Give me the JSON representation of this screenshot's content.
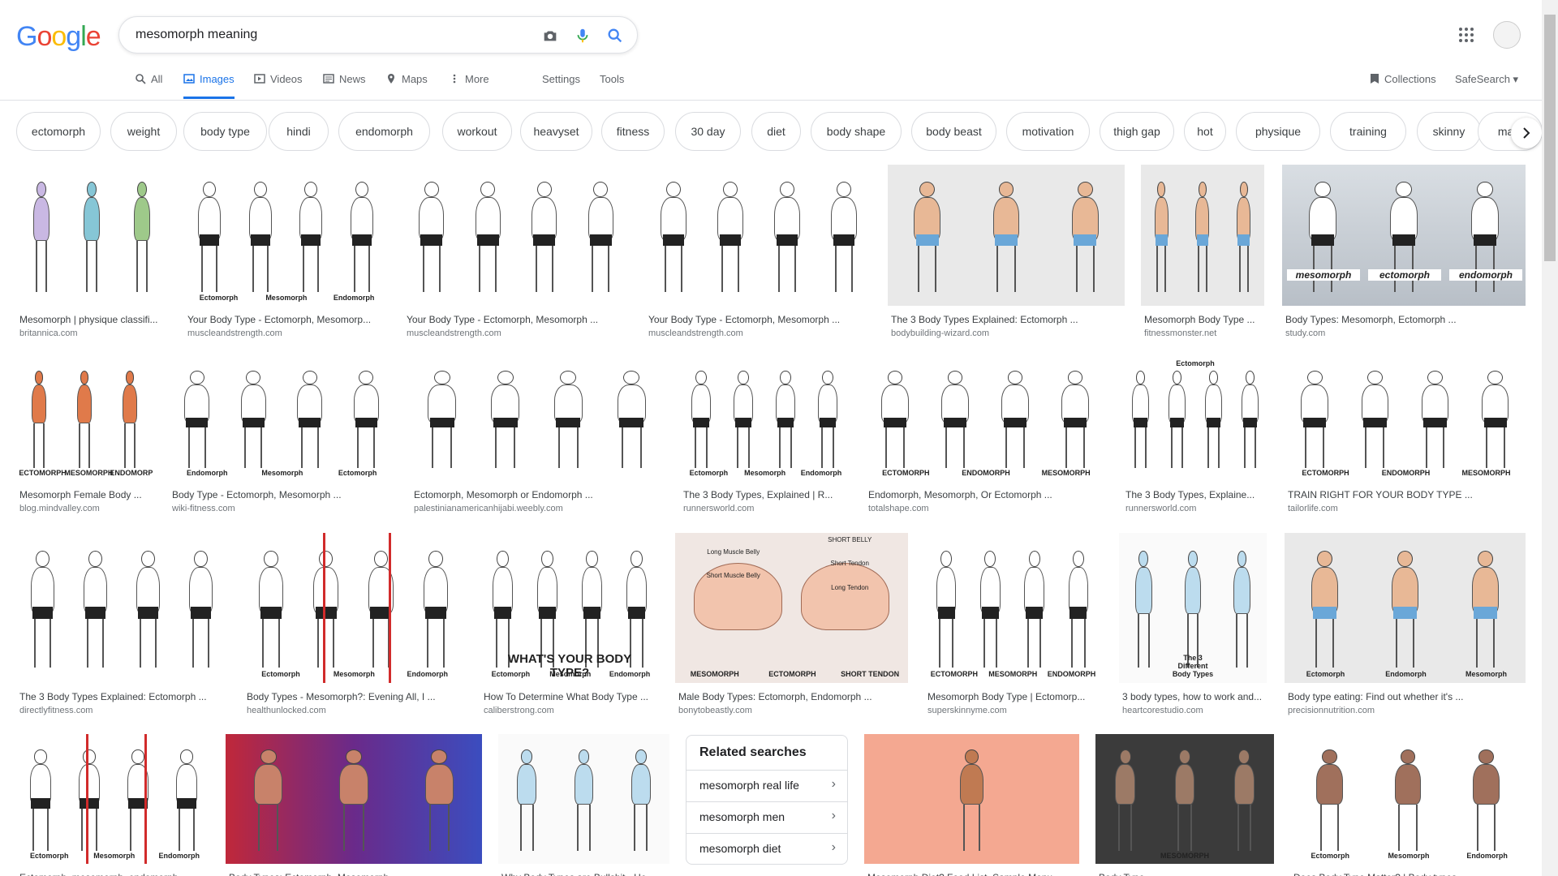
{
  "logo": {
    "letters": [
      "G",
      "o",
      "o",
      "g",
      "l",
      "e"
    ],
    "colors": [
      "#4285F4",
      "#EA4335",
      "#FBBC05",
      "#4285F4",
      "#34A853",
      "#EA4335"
    ]
  },
  "search": {
    "query": "mesomorph meaning"
  },
  "tabs": [
    {
      "label": "All",
      "icon": "search-icon"
    },
    {
      "label": "Images",
      "icon": "image-icon",
      "active": true
    },
    {
      "label": "Videos",
      "icon": "video-icon"
    },
    {
      "label": "News",
      "icon": "news-icon"
    },
    {
      "label": "Maps",
      "icon": "map-icon"
    },
    {
      "label": "More",
      "icon": "more-vert-icon"
    },
    {
      "label": "Settings"
    },
    {
      "label": "Tools"
    }
  ],
  "right_tools": {
    "collections": "Collections",
    "safesearch": "SafeSearch"
  },
  "chips": [
    "ectomorph",
    "weight",
    "body type",
    "hindi",
    "endomorph",
    "workout",
    "heavyset",
    "fitness",
    "30 day",
    "diet",
    "body shape",
    "body beast",
    "motivation",
    "thigh gap",
    "hot",
    "physique",
    "training",
    "skinny",
    "male"
  ],
  "results": [
    {
      "title": "Mesomorph | physique classifi...",
      "source": "britannica.com",
      "theme": "color",
      "labels": []
    },
    {
      "title": "Your Body Type - Ectomorph, Mesomorp...",
      "source": "muscleandstrength.com",
      "theme": "line",
      "labels": [
        "Ectomorph",
        "Mesomorph",
        "Endomorph"
      ]
    },
    {
      "title": "Your Body Type - Ectomorph, Mesomorph ...",
      "source": "muscleandstrength.com",
      "theme": "line",
      "labels": []
    },
    {
      "title": "Your Body Type - Ectomorph, Mesomorph ...",
      "source": "muscleandstrength.com",
      "theme": "line",
      "labels": []
    },
    {
      "title": "The 3 Body Types Explained: Ectomorph ...",
      "source": "bodybuilding-wizard.com",
      "theme": "blue",
      "labels": []
    },
    {
      "title": "Mesomorph Body Type ...",
      "source": "fitnessmonster.net",
      "theme": "blue",
      "labels": []
    },
    {
      "title": "Body Types: Mesomorph, Ectomorph ...",
      "source": "study.com",
      "theme": "dark",
      "labels": [
        "mesomorph",
        "ectomorph",
        "endomorph"
      ]
    },
    {
      "title": "Mesomorph Female Body ...",
      "source": "blog.mindvalley.com",
      "theme": "orange",
      "labels": [
        "ECTOMORPH",
        "MESOMORPH",
        "ENDOMORPH"
      ]
    },
    {
      "title": "Body Type - Ectomorph, Mesomorph ...",
      "source": "wiki-fitness.com",
      "theme": "line",
      "labels": [
        "Endomorph",
        "Mesomorph",
        "Ectomorph"
      ]
    },
    {
      "title": "Ectomorph, Mesomorph or Endomorph ...",
      "source": "palestinianamericanhijabi.weebly.com",
      "theme": "line",
      "labels": []
    },
    {
      "title": "The 3 Body Types, Explained | R...",
      "source": "runnersworld.com",
      "theme": "line",
      "labels": [
        "Ectomorph",
        "Mesomorph",
        "Endomorph"
      ]
    },
    {
      "title": "Endomorph, Mesomorph, Or Ectomorph ...",
      "source": "totalshape.com",
      "theme": "line",
      "labels": [
        "ECTOMORPH",
        "ENDOMORPH",
        "MESOMORPH"
      ]
    },
    {
      "title": "The 3 Body Types, Explaine...",
      "source": "runnersworld.com",
      "theme": "line",
      "labels": [
        "Ectomorph"
      ]
    },
    {
      "title": "TRAIN RIGHT FOR YOUR BODY TYPE ...",
      "source": "tailorlife.com",
      "theme": "line",
      "labels": [
        "ECTOMORPH",
        "ENDOMORPH",
        "MESOMORPH"
      ]
    },
    {
      "title": "The 3 Body Types Explained: Ectomorph ...",
      "source": "directlyfitness.com",
      "theme": "line",
      "labels": []
    },
    {
      "title": "Body Types - Mesomorph?: Evening All, I ...",
      "source": "healthunlocked.com",
      "theme": "red",
      "labels": [
        "Ectomorph",
        "Mesomorph",
        "Endomorph"
      ]
    },
    {
      "title": "How To Determine What Body Type ...",
      "source": "caliberstrong.com",
      "theme": "line",
      "labels": [
        "Ectomorph",
        "Mesomorph",
        "Endomorph",
        "WHAT'S YOUR BODY TYPE?"
      ]
    },
    {
      "title": "Male Body Types: Ectomorph, Endomorph ...",
      "source": "bonytobeastly.com",
      "theme": "arms",
      "labels": [
        "MESOMORPH",
        "ECTOMORPH",
        "SHORT TENDON",
        "SHORT BELLY",
        "Long Muscle Belly",
        "Short Tendon",
        "Short Muscle Belly",
        "Long Tendon"
      ]
    },
    {
      "title": "Mesomorph Body Type | Ectomorp...",
      "source": "superskinnyme.com",
      "theme": "line",
      "labels": [
        "ECTOMORPH",
        "MESOMORPH",
        "ENDOMORPH"
      ]
    },
    {
      "title": "3 body types, how to work and...",
      "source": "heartcorestudio.com",
      "theme": "chart",
      "labels": [
        "The 3 Different Body Types"
      ]
    },
    {
      "title": "Body type eating: Find out whether it's ...",
      "source": "precisionnutrition.com",
      "theme": "blue",
      "labels": [
        "Ectomorph",
        "Endomorph",
        "Mesomorph"
      ]
    },
    {
      "title": "Ectomorph, mesomorph, endomorph ...",
      "source": "",
      "theme": "red",
      "labels": [
        "Ectomorph",
        "Mesomorph",
        "Endomorph"
      ]
    },
    {
      "title": "Body Types: Ectomorph, Mesomorph ...",
      "source": "",
      "theme": "gradient",
      "labels": []
    },
    {
      "title": "Why Body Types are Bullshit - He...",
      "source": "",
      "theme": "chart",
      "labels": []
    },
    {
      "title": "Mesomorph Diet? Food List, Sample Menu ...",
      "source": "",
      "theme": "food",
      "labels": []
    },
    {
      "title": "Body Type ...",
      "source": "",
      "theme": "photo",
      "labels": [
        "MESOMORPH"
      ]
    },
    {
      "title": "Does Body Type Matter? | Body types ...",
      "source": "",
      "theme": "skin",
      "labels": [
        "Ectomorph",
        "Mesomorph",
        "Endomorph"
      ]
    }
  ],
  "related": {
    "title": "Related searches",
    "items": [
      "mesomorph real life",
      "mesomorph men",
      "mesomorph diet"
    ]
  }
}
